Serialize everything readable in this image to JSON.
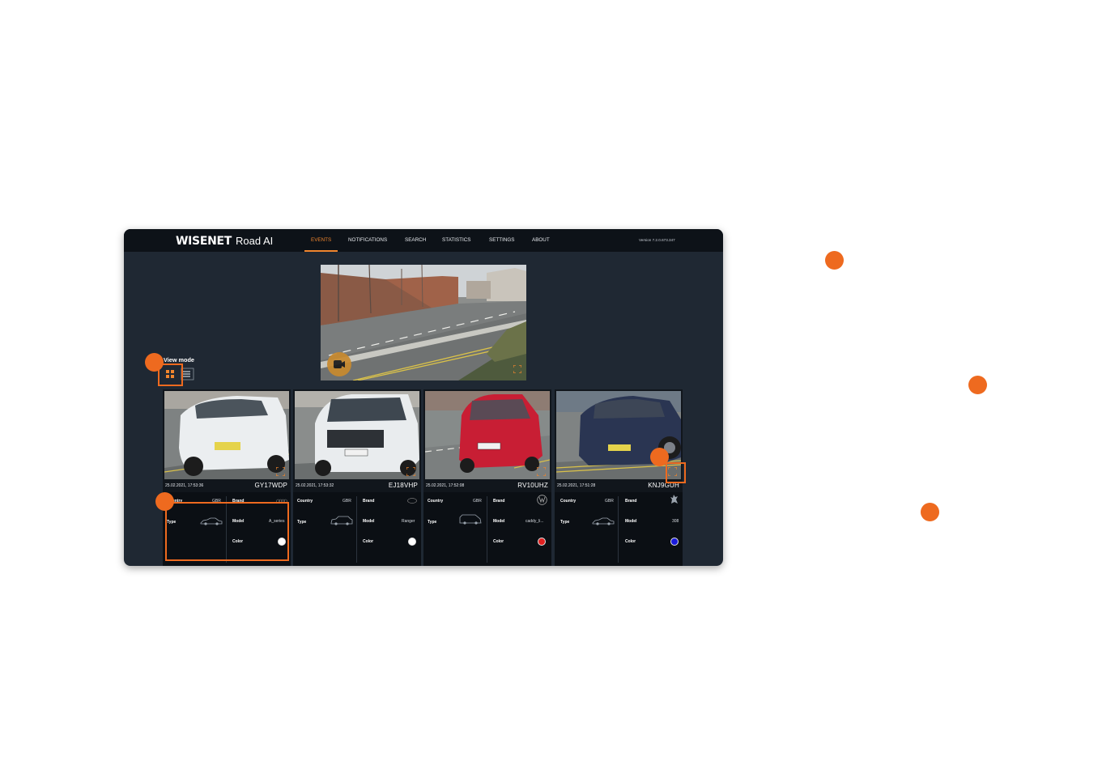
{
  "app": {
    "brand": "WISENET",
    "product": "Road AI",
    "version": "Version 7.2.0.673.347"
  },
  "nav": [
    {
      "label": "EVENTS",
      "active": true
    },
    {
      "label": "NOTIFICATIONS",
      "active": false
    },
    {
      "label": "SEARCH",
      "active": false
    },
    {
      "label": "STATISTICS",
      "active": false
    },
    {
      "label": "SETTINGS",
      "active": false
    },
    {
      "label": "ABOUT",
      "active": false
    }
  ],
  "view_mode": {
    "label": "View mode",
    "selected": "grid",
    "icons": [
      "grid-view-icon",
      "list-view-icon"
    ]
  },
  "labels": {
    "country": "Country",
    "type": "Type",
    "brand": "Brand",
    "model": "Model",
    "color": "Color"
  },
  "events": [
    {
      "date": "25.02.2021, 17:53:36",
      "plate": "GY17WDP",
      "country": "GBR",
      "type_icon": "car-sedan-icon",
      "brand_icon": "audi-logo-icon",
      "model": "A_series",
      "color": "#ffffff",
      "car_color": "#ebeef0"
    },
    {
      "date": "25.02.2021, 17:53:32",
      "plate": "EJ18VHP",
      "country": "GBR",
      "type_icon": "car-suv-icon",
      "brand_icon": "ford-logo-icon",
      "model": "Ranger",
      "color": "#ffffff",
      "car_color": "#e9ecee"
    },
    {
      "date": "25.02.2021, 17:52:08",
      "plate": "RV10UHZ",
      "country": "GBR",
      "type_icon": "van-icon",
      "brand_icon": "volkswagen-logo-icon",
      "model": "caddy_li...",
      "color": "#e02020",
      "car_color": "#c81e34"
    },
    {
      "date": "25.02.2021, 17:51:28",
      "plate": "KNJ9GUH",
      "country": "GBR",
      "type_icon": "car-sedan-icon",
      "brand_icon": "peugeot-logo-icon",
      "model": "308",
      "color": "#1a1adc",
      "car_color": "#2a3552"
    }
  ],
  "colors": {
    "accent": "#ee6a1f",
    "nav_active": "#f0852d",
    "app_bg": "#1f2833",
    "topbar_bg": "#0d1218"
  }
}
